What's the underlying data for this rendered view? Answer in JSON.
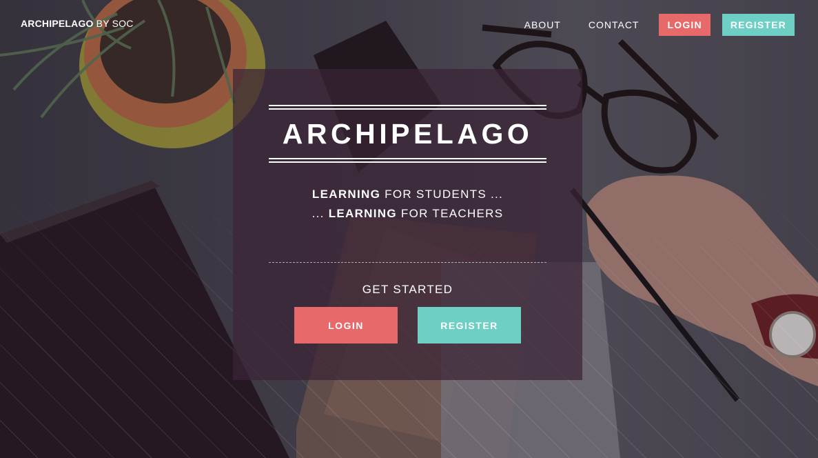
{
  "brand": {
    "name": "ARCHIPELAGO",
    "suffix": "BY SOC"
  },
  "nav": {
    "about": "ABOUT",
    "contact": "CONTACT",
    "login": "LOGIN",
    "register": "REGISTER"
  },
  "hero": {
    "title": "ARCHIPELAGO",
    "line1_bold": "LEARNING",
    "line1_rest": "FOR STUDENTS ...",
    "line2_prefix": "...",
    "line2_bold": "LEARNING",
    "line2_rest": "FOR TEACHERS",
    "get_started": "GET STARTED",
    "login": "LOGIN",
    "register": "REGISTER"
  },
  "colors": {
    "login": "#e8696a",
    "register": "#6ed0c5",
    "panel": "#3a2436"
  }
}
